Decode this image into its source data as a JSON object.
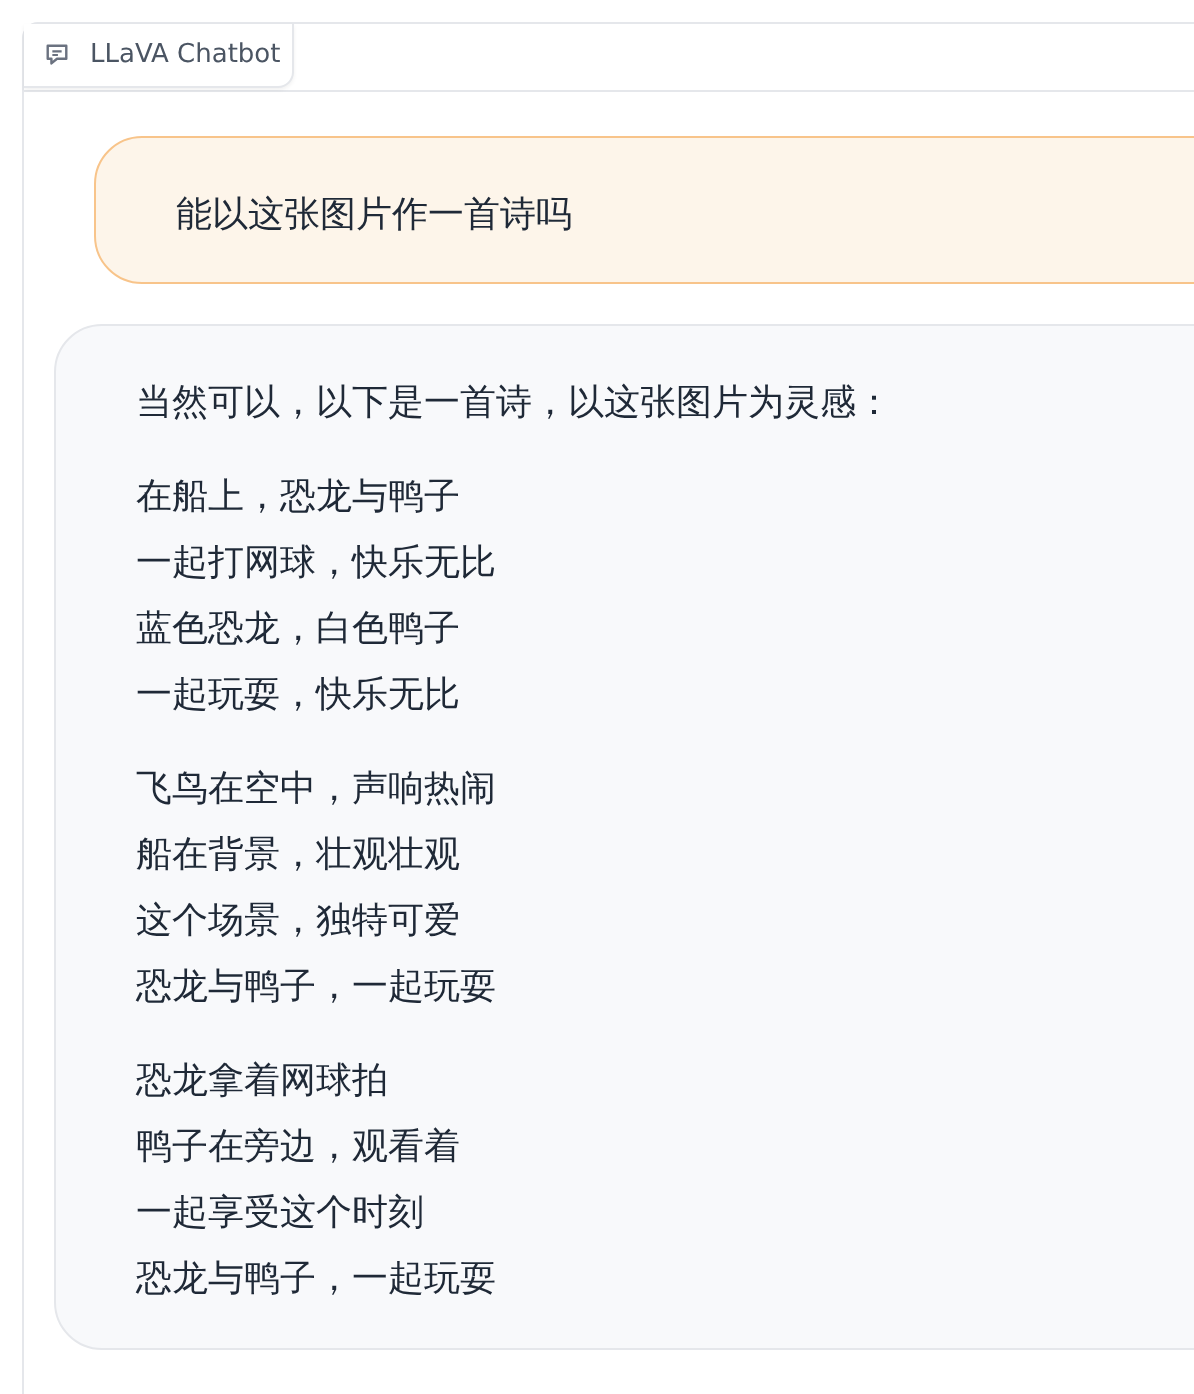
{
  "chatbot": {
    "label": "LLaVA Chatbot",
    "messages": [
      {
        "kind": "user",
        "paragraphs": [
          [
            "能以这张图片作一首诗吗"
          ]
        ]
      },
      {
        "kind": "bot",
        "paragraphs": [
          [
            "当然可以，以下是一首诗，以这张图片为灵感："
          ],
          [
            "在船上，恐龙与鸭子",
            "一起打网球，快乐无比",
            "蓝色恐龙，白色鸭子",
            "一起玩耍，快乐无比"
          ],
          [
            "飞鸟在空中，声响热闹",
            "船在背景，壮观壮观",
            "这个场景，独特可爱",
            "恐龙与鸭子，一起玩耍"
          ],
          [
            "恐龙拿着网球拍",
            "鸭子在旁边，观看着",
            "一起享受这个时刻",
            "恐龙与鸭子，一起玩耍"
          ]
        ]
      }
    ]
  }
}
